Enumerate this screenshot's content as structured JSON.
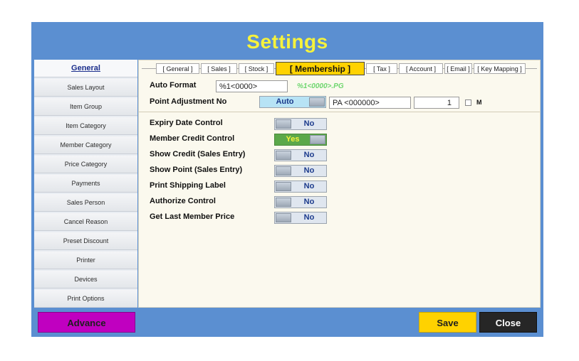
{
  "window": {
    "title": "Settings"
  },
  "sidebar": {
    "items": [
      {
        "label": "General",
        "active": true
      },
      {
        "label": "Sales Layout"
      },
      {
        "label": "Item Group"
      },
      {
        "label": "Item Category"
      },
      {
        "label": "Member Category"
      },
      {
        "label": "Price Category"
      },
      {
        "label": "Payments"
      },
      {
        "label": "Sales Person"
      },
      {
        "label": "Cancel Reason"
      },
      {
        "label": "Preset Discount"
      },
      {
        "label": "Printer"
      },
      {
        "label": "Devices"
      },
      {
        "label": "Print Options"
      }
    ]
  },
  "tabs": [
    {
      "label": "[  General  ]"
    },
    {
      "label": "[  Sales  ]"
    },
    {
      "label": "[  Stock  ]"
    },
    {
      "label": "[  Membership  ]",
      "active": true
    },
    {
      "label": "[  Tax  ]"
    },
    {
      "label": "[  Account  ]"
    },
    {
      "label": "[  Email  ]"
    },
    {
      "label": "[  Key Mapping  ]"
    }
  ],
  "membership": {
    "auto_format": {
      "label": "Auto Format",
      "value": "%1<0000>",
      "hint": "%1<0000>.PG"
    },
    "point_adjustment": {
      "label": "Point Adjustment No",
      "toggle": "Auto",
      "format": "PA <000000>",
      "number": "1",
      "checkbox_label": "M"
    },
    "settings": [
      {
        "label": "Expiry Date Control",
        "value": "No",
        "on": false
      },
      {
        "label": "Member Credit Control",
        "value": "Yes",
        "on": true
      },
      {
        "label": "Show Credit (Sales Entry)",
        "value": "No",
        "on": false
      },
      {
        "label": "Show Point (Sales Entry)",
        "value": "No",
        "on": false
      },
      {
        "label": "Print Shipping Label",
        "value": "No",
        "on": false
      },
      {
        "label": "Authorize Control",
        "value": "No",
        "on": false
      },
      {
        "label": "Get Last Member Price",
        "value": "No",
        "on": false
      }
    ]
  },
  "buttons": {
    "advance": "Advance",
    "save": "Save",
    "close": "Close"
  },
  "colors": {
    "window_bg": "#5b8fd1",
    "title": "#f6f23c",
    "advance": "#c000c0",
    "save": "#ffd200",
    "close": "#262626"
  }
}
